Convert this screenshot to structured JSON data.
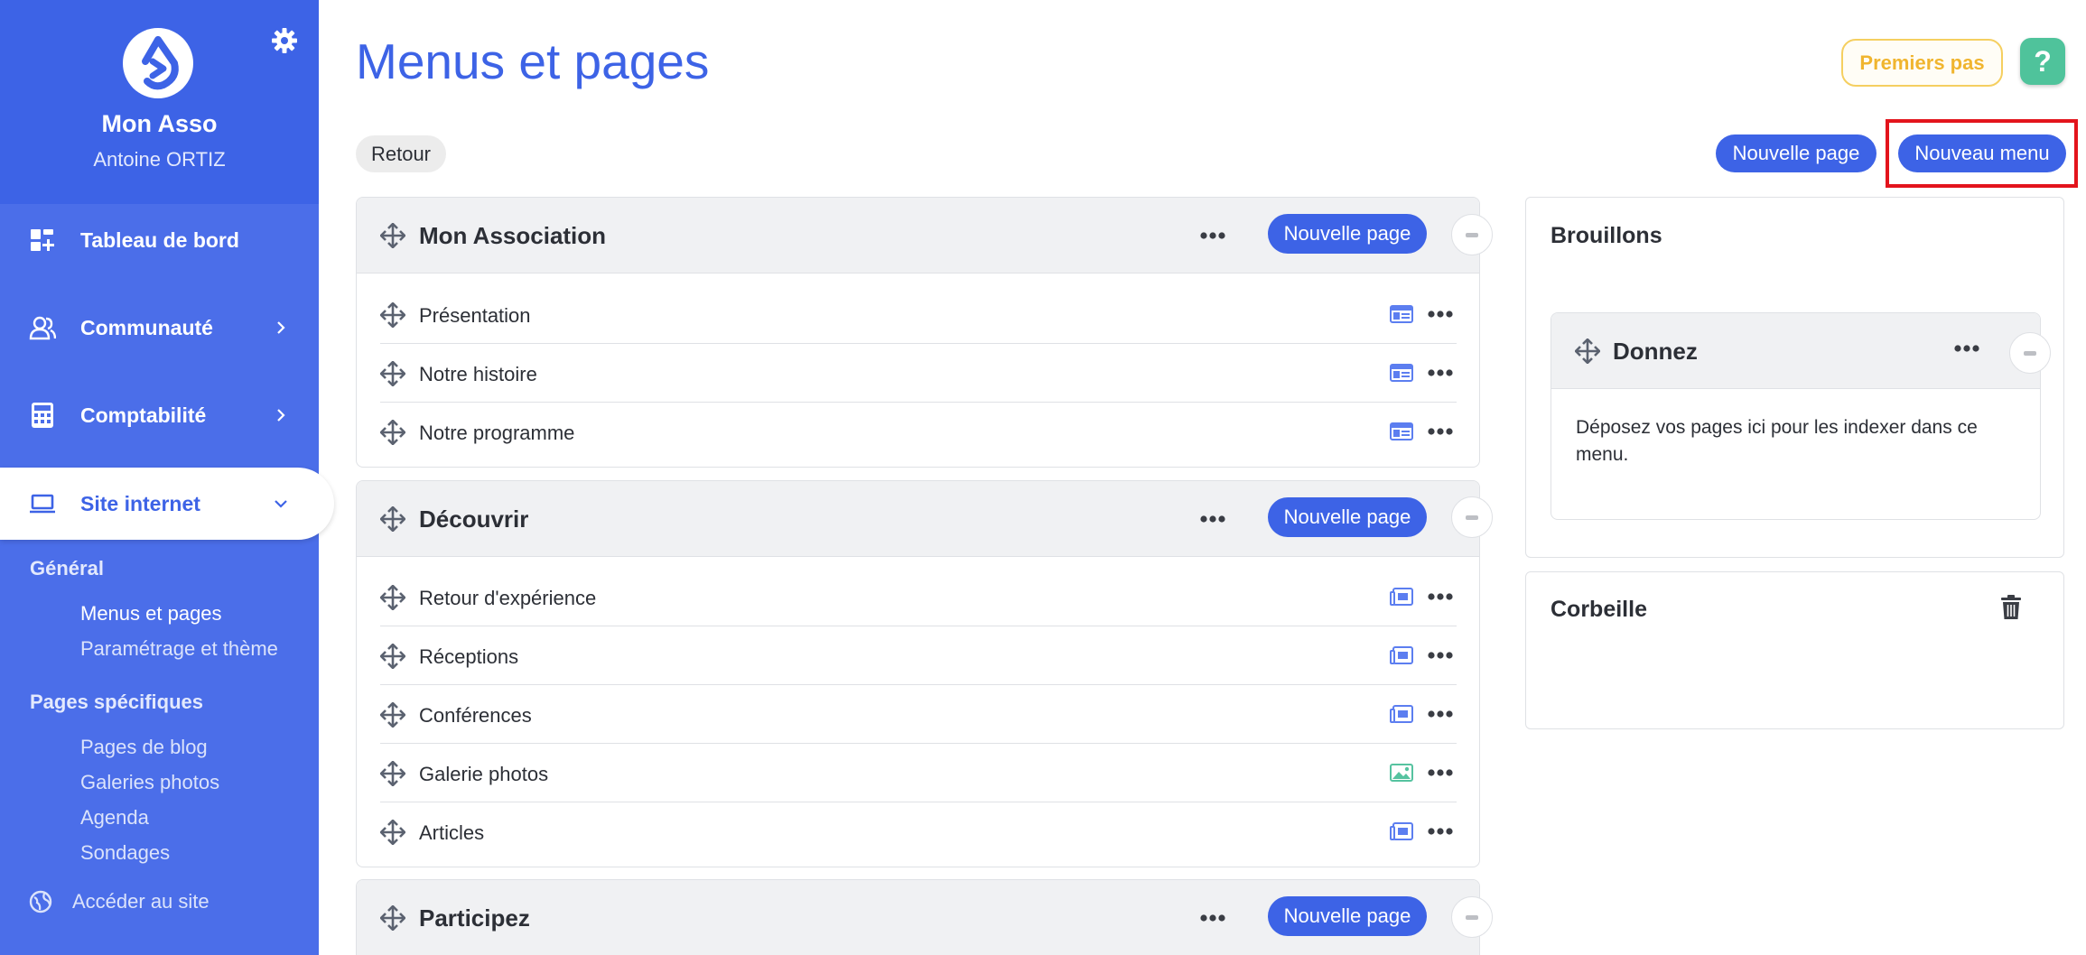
{
  "sidebar": {
    "org_name": "Mon Asso",
    "user_name": "Antoine ORTIZ",
    "nav": [
      {
        "label": "Tableau de bord",
        "icon": "dashboard-icon"
      },
      {
        "label": "Communauté",
        "icon": "community-icon"
      },
      {
        "label": "Comptabilité",
        "icon": "calculator-icon"
      },
      {
        "label": "Site internet",
        "icon": "laptop-icon",
        "active": true
      }
    ],
    "section_general": "Général",
    "general_links": [
      "Menus et pages",
      "Paramétrage et thème"
    ],
    "section_pages": "Pages spécifiques",
    "page_links": [
      "Pages de blog",
      "Galeries photos",
      "Agenda",
      "Sondages"
    ],
    "access_site": "Accéder au site"
  },
  "header": {
    "title": "Menus et pages",
    "premiers_pas": "Premiers pas",
    "help": "?"
  },
  "toolbar": {
    "retour": "Retour",
    "nouvelle_page": "Nouvelle page",
    "nouveau_menu": "Nouveau menu"
  },
  "menus": [
    {
      "title": "Mon Association",
      "button": "Nouvelle page",
      "pages": [
        {
          "label": "Présentation",
          "type": "layout-page-icon"
        },
        {
          "label": "Notre histoire",
          "type": "layout-page-icon"
        },
        {
          "label": "Notre programme",
          "type": "layout-page-icon"
        }
      ]
    },
    {
      "title": "Découvrir",
      "button": "Nouvelle page",
      "pages": [
        {
          "label": "Retour d'expérience",
          "type": "blog-page-icon"
        },
        {
          "label": "Réceptions",
          "type": "blog-page-icon"
        },
        {
          "label": "Conférences",
          "type": "blog-page-icon"
        },
        {
          "label": "Galerie photos",
          "type": "image-gallery-icon"
        },
        {
          "label": "Articles",
          "type": "blog-page-icon"
        }
      ]
    },
    {
      "title": "Participez",
      "button": "Nouvelle page",
      "pages": []
    }
  ],
  "drafts": {
    "title": "Brouillons",
    "menu_title": "Donnez",
    "drop_text": "Déposez vos pages ici pour les indexer dans ce menu."
  },
  "trash": {
    "title": "Corbeille"
  },
  "colors": {
    "brand": "#3d63e6",
    "sidebar": "#4b6ee9",
    "accent_yellow": "#f0b52f",
    "help_green": "#4fc39b",
    "highlight_red": "#e3141c"
  }
}
